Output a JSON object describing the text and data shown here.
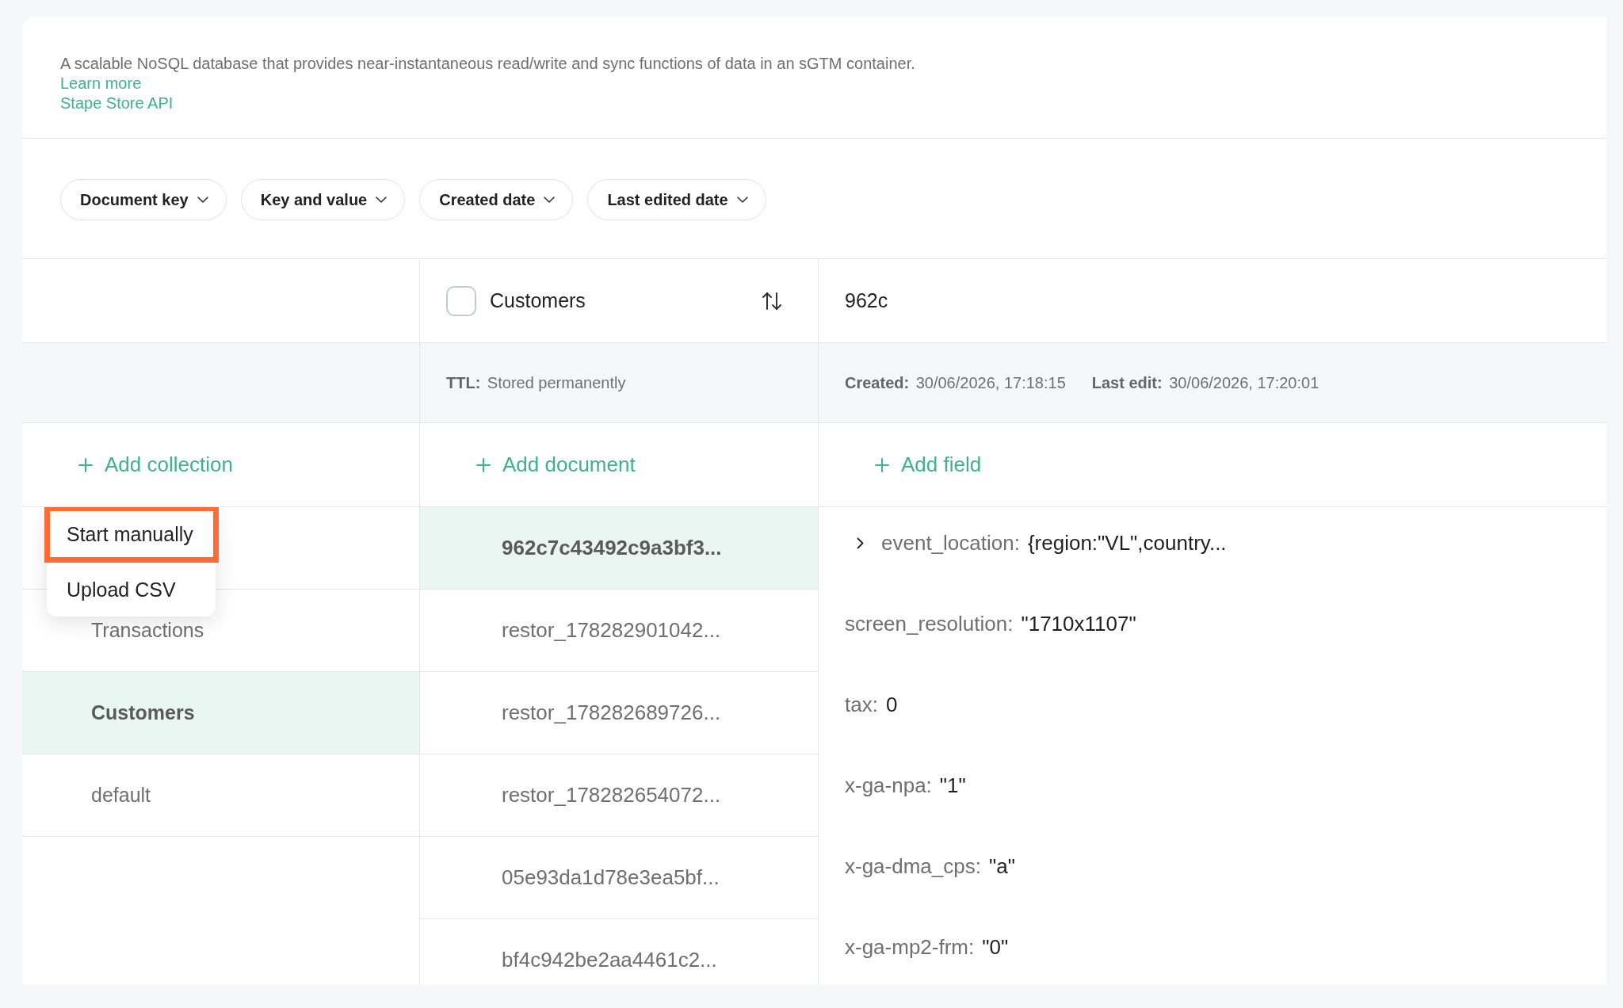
{
  "description": {
    "text": "A scalable NoSQL database that provides near-instantaneous read/write and sync functions of data in an sGTM container.",
    "links": [
      "Learn more",
      "Stape Store API"
    ]
  },
  "filters": [
    "Document key",
    "Key and value",
    "Created date",
    "Last edited date"
  ],
  "header": {
    "collection": {
      "label": "Customers",
      "checked": false
    },
    "document_id": "962c"
  },
  "meta": {
    "ttl": {
      "label": "TTL:",
      "value": "Stored permanently"
    },
    "created": {
      "label": "Created:",
      "value": "30/06/2026, 17:18:15"
    },
    "edited": {
      "label": "Last edit:",
      "value": "30/06/2026, 17:20:01"
    }
  },
  "actions": [
    "Add collection",
    "Add document",
    "Add field"
  ],
  "collections": [
    {
      "name": "Transactions",
      "selected": false
    },
    {
      "name": "Customers",
      "selected": true
    },
    {
      "name": "default",
      "selected": false
    }
  ],
  "documents": [
    {
      "key": "962c7c43492c9a3bf3...",
      "selected": true
    },
    {
      "key": "restor_178282901042...",
      "selected": false
    },
    {
      "key": "restor_178282689726...",
      "selected": false
    },
    {
      "key": "restor_178282654072...",
      "selected": false
    },
    {
      "key": "05e93da1d78e3ea5bf...",
      "selected": false
    },
    {
      "key": "bf4c942be2aa4461c2...",
      "selected": false
    }
  ],
  "fields": [
    {
      "key": "event_location:",
      "value": "{region:\"VL\",country...",
      "expandable": true
    },
    {
      "key": "screen_resolution:",
      "value": "\"1710x1107\"",
      "expandable": false
    },
    {
      "key": "tax:",
      "value": "0",
      "expandable": false
    },
    {
      "key": "x-ga-npa:",
      "value": "\"1\"",
      "expandable": false
    },
    {
      "key": "x-ga-dma_cps:",
      "value": "\"a\"",
      "expandable": false
    },
    {
      "key": "x-ga-mp2-frm:",
      "value": "\"0\"",
      "expandable": false
    }
  ],
  "menu": [
    {
      "label": "Start manually",
      "highlighted": true
    },
    {
      "label": "Upload CSV",
      "highlighted": false
    }
  ]
}
